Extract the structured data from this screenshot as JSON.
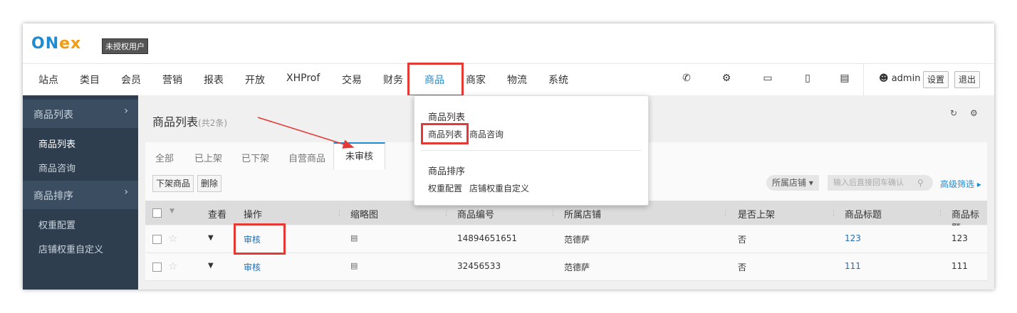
{
  "brand": {
    "logo_on": "ON",
    "logo_e": "e",
    "logo_x": "x",
    "badge": "未授权用户"
  },
  "topnav": {
    "items": [
      "站点",
      "类目",
      "会员",
      "营销",
      "报表",
      "开放",
      "XHProf",
      "交易",
      "财务",
      "商品",
      "商家",
      "物流",
      "系统"
    ],
    "active": "商品",
    "icons": [
      "phone-icon",
      "cogs-icon",
      "desktop-icon",
      "mobile-icon",
      "tablet-icon"
    ],
    "user": "admin",
    "settings_label": "设置",
    "logout_label": "退出"
  },
  "sidebar": {
    "groups": [
      {
        "title": "商品列表",
        "items": [
          "商品列表",
          "商品咨询"
        ]
      },
      {
        "title": "商品排序",
        "items": [
          "权重配置",
          "店铺权重自定义"
        ]
      }
    ],
    "current": "商品列表"
  },
  "main": {
    "title": "商品列表",
    "count": "(共2条)",
    "tabs": [
      "全部",
      "已上架",
      "已下架",
      "自营商品",
      "未审核"
    ],
    "active_tab": "未审核",
    "toolbar": {
      "offshelf_label": "下架商品",
      "delete_label": "删除",
      "store_filter": "所属店铺 ▾",
      "search_placeholder": "输入后直接回车确认",
      "advanced": "高级筛选"
    },
    "columns": [
      "查看",
      "操作",
      "缩略图",
      "商品编号",
      "所属店铺",
      "是否上架",
      "商品标题",
      "商品标题"
    ],
    "rows": [
      {
        "action": "审核",
        "id": "14894651651",
        "store": "范德萨",
        "on_shelf": "否",
        "title_link": "123",
        "title": "123"
      },
      {
        "action": "审核",
        "id": "32456533",
        "store": "范德萨",
        "on_shelf": "否",
        "title_link": "111",
        "title": "111"
      }
    ]
  },
  "dropdown": {
    "sections": [
      {
        "title": "商品列表",
        "links": [
          "商品列表",
          "商品咨询"
        ]
      },
      {
        "title": "商品排序",
        "links": [
          "权重配置",
          "店铺权重自定义"
        ]
      }
    ]
  },
  "colors": {
    "accent": "#1f8bd1",
    "highlight_box": "#e53935",
    "sidebar": "#2f3e4e",
    "arrow": "#e53935"
  }
}
